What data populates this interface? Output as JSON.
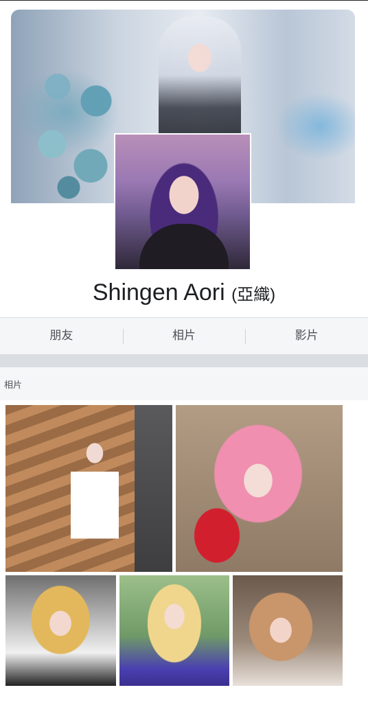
{
  "profile": {
    "name": "Shingen Aori",
    "alt_name": "(亞織)"
  },
  "tabs": [
    {
      "label": "朋友"
    },
    {
      "label": "相片"
    },
    {
      "label": "影片"
    }
  ],
  "photos_section": {
    "title": "相片"
  }
}
